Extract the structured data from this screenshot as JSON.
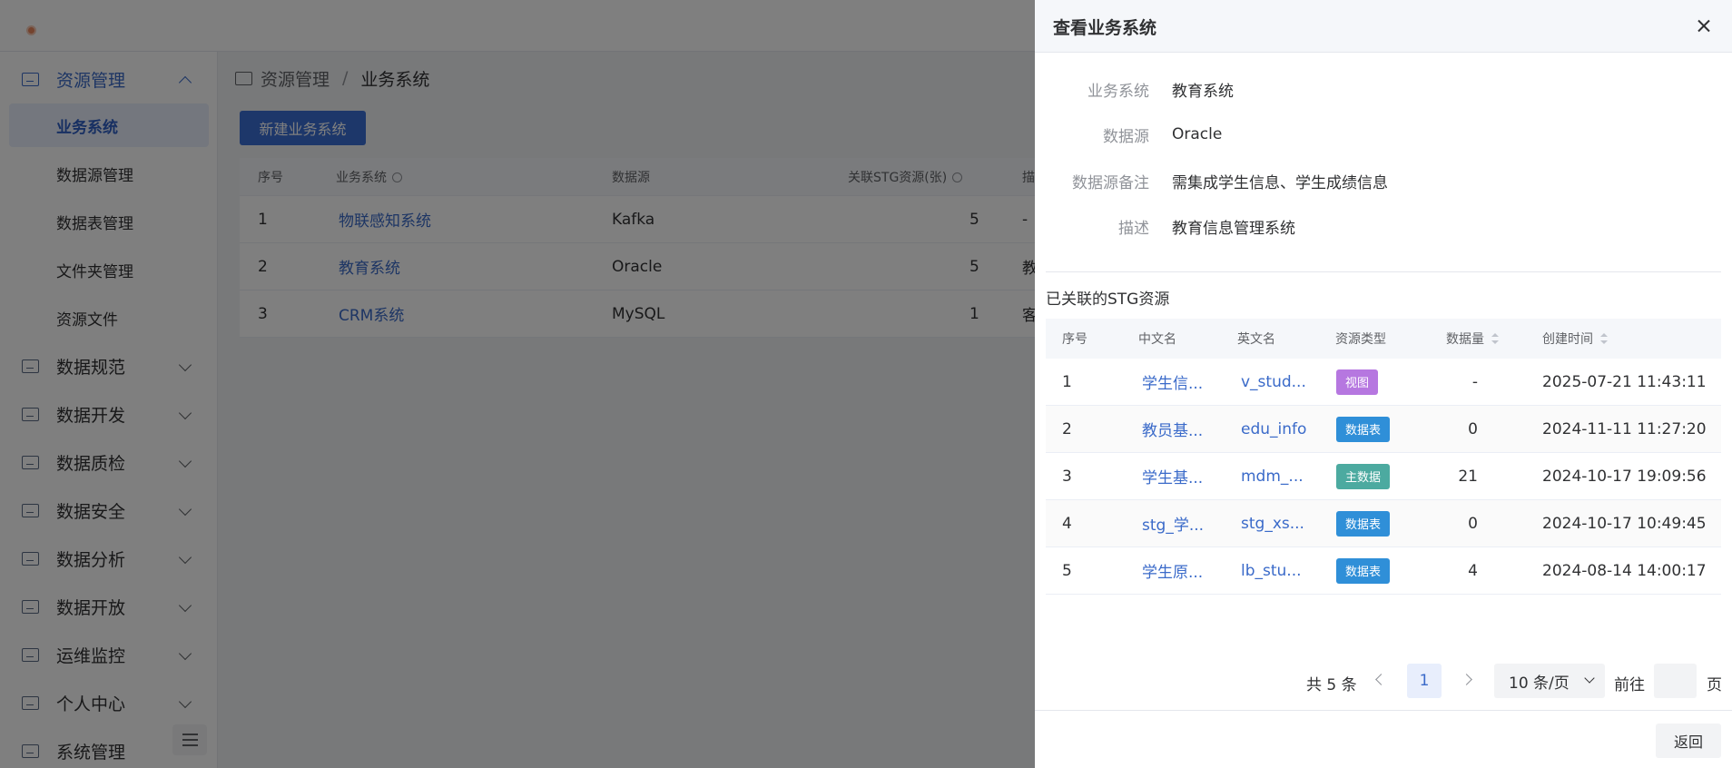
{
  "sidebar": {
    "groups": [
      {
        "label": "资源管理",
        "icon": "monitor-icon",
        "expanded": true
      },
      {
        "label": "数据规范",
        "icon": "document-icon"
      },
      {
        "label": "数据开发",
        "icon": "code-icon"
      },
      {
        "label": "数据质检",
        "icon": "check-icon"
      },
      {
        "label": "数据安全",
        "icon": "shield-icon"
      },
      {
        "label": "数据分析",
        "icon": "analysis-icon"
      },
      {
        "label": "数据开放",
        "icon": "open-icon"
      },
      {
        "label": "运维监控",
        "icon": "monitor-chart-icon"
      },
      {
        "label": "个人中心",
        "icon": "user-icon"
      },
      {
        "label": "系统管理",
        "icon": "settings-icon"
      }
    ],
    "sub_items": [
      "业务系统",
      "数据源管理",
      "数据表管理",
      "文件夹管理",
      "资源文件"
    ],
    "active_sub": "业务系统"
  },
  "breadcrumb": {
    "root": "资源管理",
    "separator": "/",
    "current": "业务系统"
  },
  "main": {
    "new_button": "新建业务系统",
    "table": {
      "headers": [
        "序号",
        "业务系统",
        "数据源",
        "关联STG资源(张)",
        "描"
      ],
      "rows": [
        {
          "index": "1",
          "name": "物联感知系统",
          "source": "Kafka",
          "count": "5",
          "desc": "-"
        },
        {
          "index": "2",
          "name": "教育系统",
          "source": "Oracle",
          "count": "5",
          "desc": "教"
        },
        {
          "index": "3",
          "name": "CRM系统",
          "source": "MySQL",
          "count": "1",
          "desc": "客"
        }
      ]
    }
  },
  "drawer": {
    "title": "查看业务系统",
    "fields": [
      {
        "label": "业务系统",
        "value": "教育系统"
      },
      {
        "label": "数据源",
        "value": "Oracle"
      },
      {
        "label": "数据源备注",
        "value": "需集成学生信息、学生成绩信息"
      },
      {
        "label": "描述",
        "value": "教育信息管理系统"
      }
    ],
    "section_title": "已关联的STG资源",
    "table": {
      "headers": [
        "序号",
        "中文名",
        "英文名",
        "资源类型",
        "数据量",
        "创建时间"
      ],
      "rows": [
        {
          "index": "1",
          "cn": "学生信...",
          "en": "v_stud...",
          "type": "视图",
          "type_color": "#b677e0",
          "count": "-",
          "created": "2025-07-21 11:43:11"
        },
        {
          "index": "2",
          "cn": "教员基...",
          "en": "edu_info",
          "type": "数据表",
          "type_color": "#2f8fd8",
          "count": "0",
          "created": "2024-11-11 11:27:20"
        },
        {
          "index": "3",
          "cn": "学生基...",
          "en": "mdm_...",
          "type": "主数据",
          "type_color": "#4caaa0",
          "count": "21",
          "created": "2024-10-17 19:09:56"
        },
        {
          "index": "4",
          "cn": "stg_学...",
          "en": "stg_xs...",
          "type": "数据表",
          "type_color": "#2f8fd8",
          "count": "0",
          "created": "2024-10-17 10:49:45"
        },
        {
          "index": "5",
          "cn": "学生原...",
          "en": "lb_stu...",
          "type": "数据表",
          "type_color": "#2f8fd8",
          "count": "4",
          "created": "2024-08-14 14:00:17"
        }
      ]
    },
    "pagination": {
      "total": "共 5 条",
      "current_page": "1",
      "page_size": "10 条/页",
      "goto_label": "前往",
      "goto_value": "",
      "page_suffix": "页"
    },
    "back_button": "返回"
  }
}
